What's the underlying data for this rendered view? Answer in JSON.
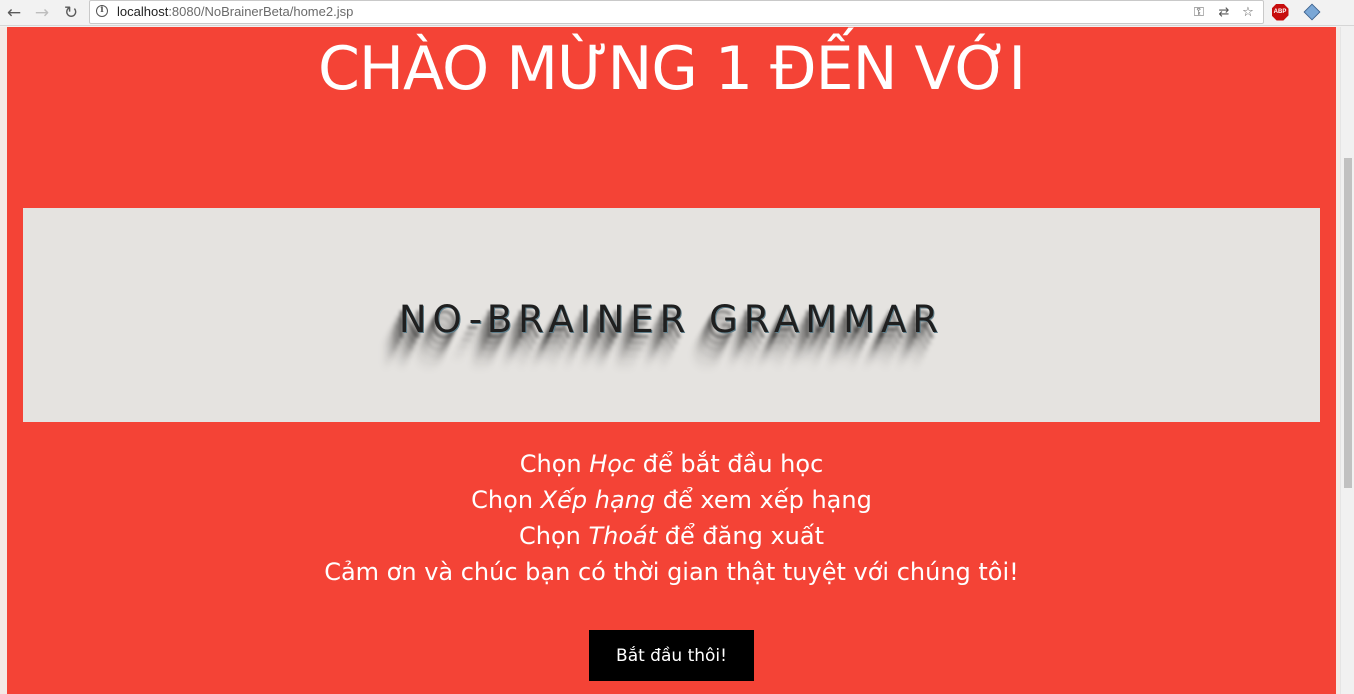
{
  "browser": {
    "url_host": "localhost",
    "url_rest": ":8080/NoBrainerBeta/home2.jsp",
    "icons": [
      "back-icon",
      "forward-icon",
      "reload-icon",
      "info-icon",
      "key-icon",
      "translate-icon",
      "star-icon",
      "adblock-icon",
      "extension-cube-icon"
    ],
    "abp_label": "ABP"
  },
  "page": {
    "welcome": "CHÀO MỪNG 1 ĐẾN VỚI",
    "logo": "NO-BRAINER GRAMMAR",
    "line1": {
      "pre": "Chọn ",
      "em": "Học",
      "post": " để bắt đầu học"
    },
    "line2": {
      "pre": "Chọn ",
      "em": "Xếp hạng",
      "post": " để xem xếp hạng"
    },
    "line3": {
      "pre": "Chọn ",
      "em": "Thoát",
      "post": " để đăng xuất"
    },
    "line4": "Cảm ơn và chúc bạn có thời gian thật tuyệt với chúng tôi!",
    "start_button": "Bắt đầu thôi!"
  },
  "colors": {
    "page_bg": "#f44336",
    "banner_bg": "#e5e3e0",
    "button_bg": "#000000",
    "text": "#ffffff"
  }
}
